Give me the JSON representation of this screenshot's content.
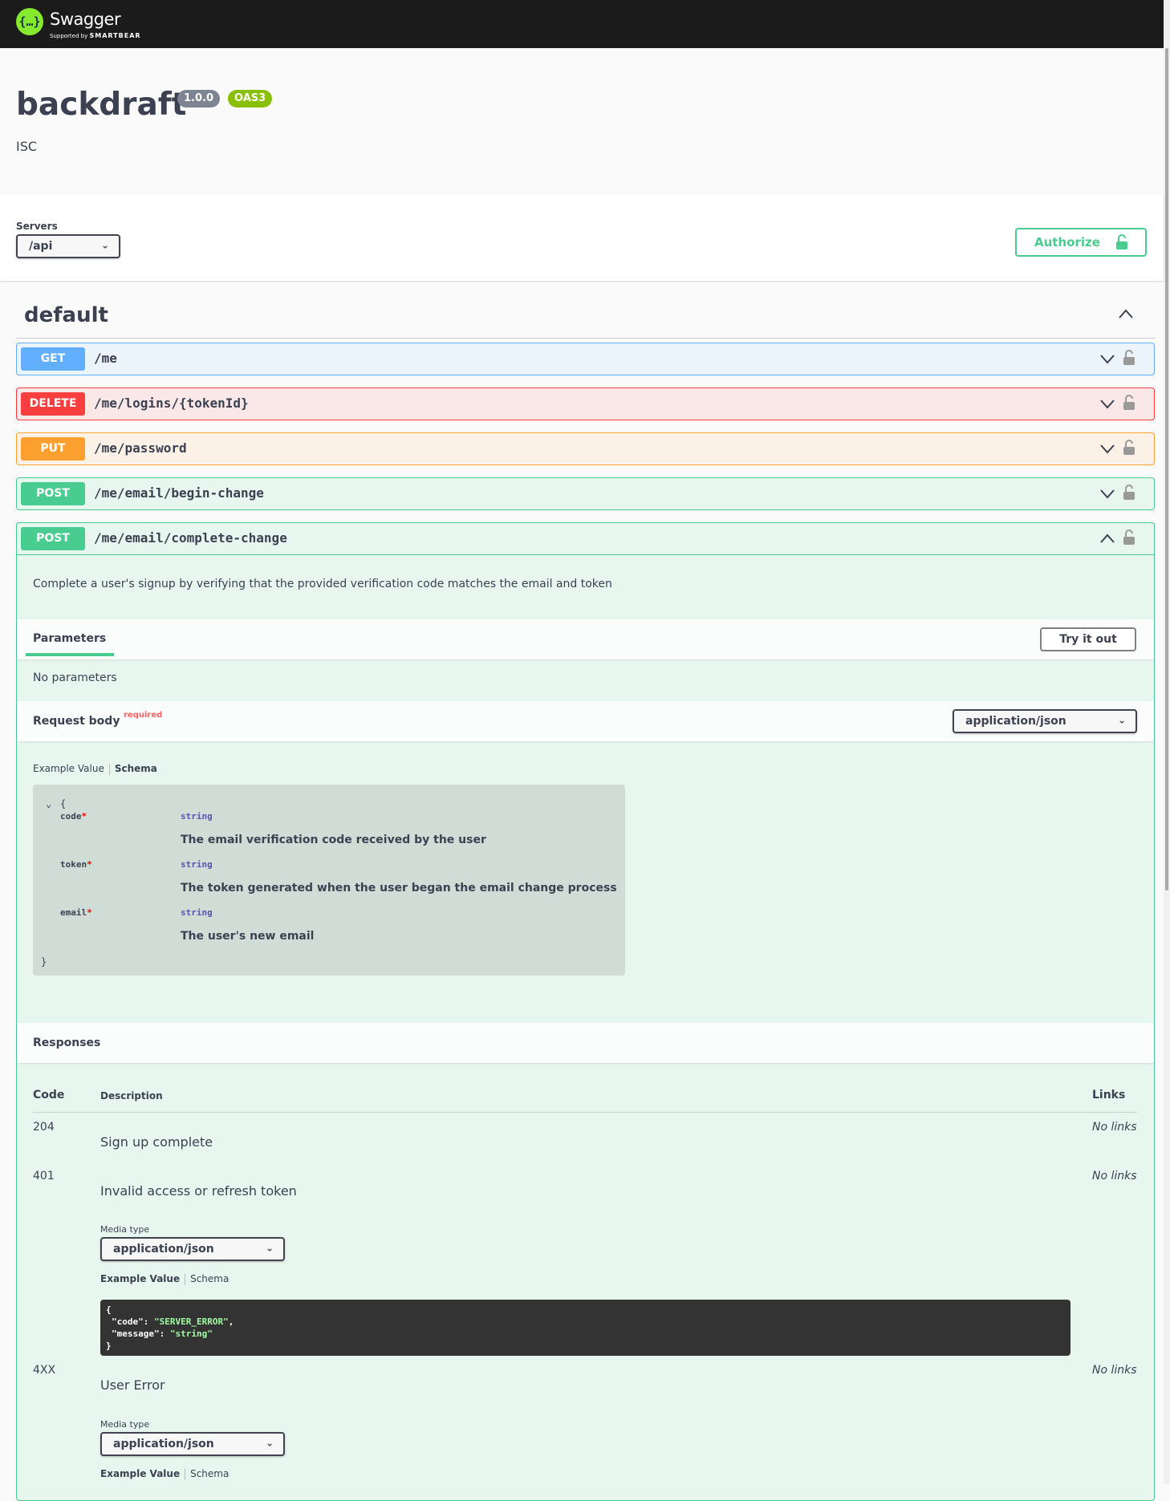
{
  "topbar": {
    "logo_glyph": "{…}",
    "brand": "Swagger",
    "supported_by": "Supported by",
    "supported_org": "SMARTBEAR"
  },
  "info": {
    "title": "backdraft",
    "version": "1.0.0",
    "oas": "OAS3",
    "license": "ISC"
  },
  "servers": {
    "label": "Servers",
    "selected": "/api",
    "authorize_label": "Authorize"
  },
  "tag": {
    "name": "default"
  },
  "operations": [
    {
      "method": "GET",
      "path": "/me",
      "color": "#61affe",
      "bg": "#ebf3fb"
    },
    {
      "method": "DELETE",
      "path": "/me/logins/{tokenId}",
      "color": "#f93e3e",
      "bg": "#fae7e7"
    },
    {
      "method": "PUT",
      "path": "/me/password",
      "color": "#fca130",
      "bg": "#fbf1e6"
    },
    {
      "method": "POST",
      "path": "/me/email/begin-change",
      "color": "#49cc90",
      "bg": "#e8f6f0"
    },
    {
      "method": "POST",
      "path": "/me/email/complete-change",
      "color": "#49cc90",
      "bg": "#e8f6f0"
    }
  ],
  "expanded": {
    "description": "Complete a user's signup by verifying that the provided verification code matches the email and token",
    "parameters_label": "Parameters",
    "try_it_out": "Try it out",
    "no_parameters": "No parameters",
    "request_body_label": "Request body",
    "required_label": "required",
    "content_type": "application/json",
    "example_value_tab": "Example Value",
    "schema_tab": "Schema",
    "schema": {
      "open": "{",
      "close": "}",
      "properties": [
        {
          "name": "code",
          "type": "string",
          "description": "The email verification code received by the user"
        },
        {
          "name": "token",
          "type": "string",
          "description": "The token generated when the user began the email change process"
        },
        {
          "name": "email",
          "type": "string",
          "description": "The user's new email"
        }
      ],
      "required_marker": "*"
    },
    "responses_label": "Responses",
    "columns": {
      "code": "Code",
      "description": "Description",
      "links": "Links"
    },
    "responses": [
      {
        "code": "204",
        "description": "Sign up complete",
        "links": "No links"
      },
      {
        "code": "401",
        "description": "Invalid access or refresh token",
        "links": "No links",
        "media_type_label": "Media type",
        "media_type": "application/json",
        "example_tab": "Example Value",
        "schema_tab": "Schema",
        "example": {
          "line1": "{",
          "key_code": "\"code\"",
          "val_code": "\"SERVER_ERROR\"",
          "key_message": "\"message\"",
          "val_message": "\"string\"",
          "line4": "}"
        }
      },
      {
        "code": "4XX",
        "description": "User Error",
        "links": "No links",
        "media_type_label": "Media type",
        "media_type": "application/json",
        "example_tab": "Example Value",
        "schema_tab": "Schema"
      }
    ]
  }
}
